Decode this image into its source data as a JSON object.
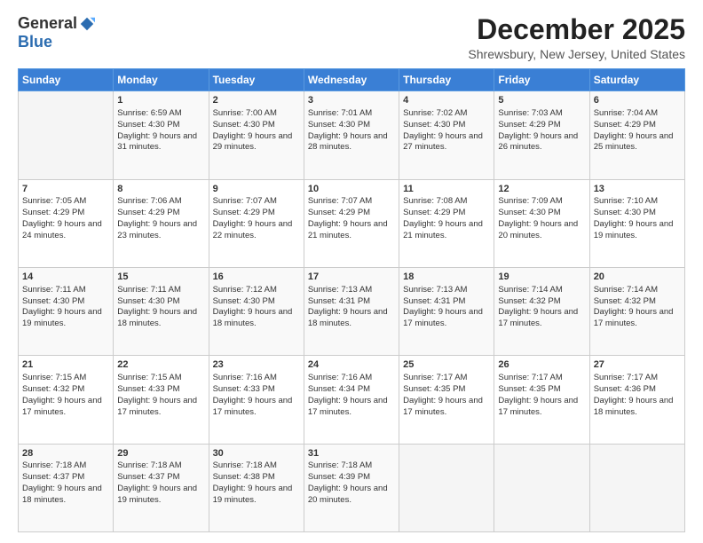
{
  "logo": {
    "general": "General",
    "blue": "Blue"
  },
  "header": {
    "month": "December 2025",
    "location": "Shrewsbury, New Jersey, United States"
  },
  "weekdays": [
    "Sunday",
    "Monday",
    "Tuesday",
    "Wednesday",
    "Thursday",
    "Friday",
    "Saturday"
  ],
  "weeks": [
    [
      {
        "day": "",
        "sunrise": "",
        "sunset": "",
        "daylight": ""
      },
      {
        "day": "1",
        "sunrise": "Sunrise: 6:59 AM",
        "sunset": "Sunset: 4:30 PM",
        "daylight": "Daylight: 9 hours and 31 minutes."
      },
      {
        "day": "2",
        "sunrise": "Sunrise: 7:00 AM",
        "sunset": "Sunset: 4:30 PM",
        "daylight": "Daylight: 9 hours and 29 minutes."
      },
      {
        "day": "3",
        "sunrise": "Sunrise: 7:01 AM",
        "sunset": "Sunset: 4:30 PM",
        "daylight": "Daylight: 9 hours and 28 minutes."
      },
      {
        "day": "4",
        "sunrise": "Sunrise: 7:02 AM",
        "sunset": "Sunset: 4:30 PM",
        "daylight": "Daylight: 9 hours and 27 minutes."
      },
      {
        "day": "5",
        "sunrise": "Sunrise: 7:03 AM",
        "sunset": "Sunset: 4:29 PM",
        "daylight": "Daylight: 9 hours and 26 minutes."
      },
      {
        "day": "6",
        "sunrise": "Sunrise: 7:04 AM",
        "sunset": "Sunset: 4:29 PM",
        "daylight": "Daylight: 9 hours and 25 minutes."
      }
    ],
    [
      {
        "day": "7",
        "sunrise": "Sunrise: 7:05 AM",
        "sunset": "Sunset: 4:29 PM",
        "daylight": "Daylight: 9 hours and 24 minutes."
      },
      {
        "day": "8",
        "sunrise": "Sunrise: 7:06 AM",
        "sunset": "Sunset: 4:29 PM",
        "daylight": "Daylight: 9 hours and 23 minutes."
      },
      {
        "day": "9",
        "sunrise": "Sunrise: 7:07 AM",
        "sunset": "Sunset: 4:29 PM",
        "daylight": "Daylight: 9 hours and 22 minutes."
      },
      {
        "day": "10",
        "sunrise": "Sunrise: 7:07 AM",
        "sunset": "Sunset: 4:29 PM",
        "daylight": "Daylight: 9 hours and 21 minutes."
      },
      {
        "day": "11",
        "sunrise": "Sunrise: 7:08 AM",
        "sunset": "Sunset: 4:29 PM",
        "daylight": "Daylight: 9 hours and 21 minutes."
      },
      {
        "day": "12",
        "sunrise": "Sunrise: 7:09 AM",
        "sunset": "Sunset: 4:30 PM",
        "daylight": "Daylight: 9 hours and 20 minutes."
      },
      {
        "day": "13",
        "sunrise": "Sunrise: 7:10 AM",
        "sunset": "Sunset: 4:30 PM",
        "daylight": "Daylight: 9 hours and 19 minutes."
      }
    ],
    [
      {
        "day": "14",
        "sunrise": "Sunrise: 7:11 AM",
        "sunset": "Sunset: 4:30 PM",
        "daylight": "Daylight: 9 hours and 19 minutes."
      },
      {
        "day": "15",
        "sunrise": "Sunrise: 7:11 AM",
        "sunset": "Sunset: 4:30 PM",
        "daylight": "Daylight: 9 hours and 18 minutes."
      },
      {
        "day": "16",
        "sunrise": "Sunrise: 7:12 AM",
        "sunset": "Sunset: 4:30 PM",
        "daylight": "Daylight: 9 hours and 18 minutes."
      },
      {
        "day": "17",
        "sunrise": "Sunrise: 7:13 AM",
        "sunset": "Sunset: 4:31 PM",
        "daylight": "Daylight: 9 hours and 18 minutes."
      },
      {
        "day": "18",
        "sunrise": "Sunrise: 7:13 AM",
        "sunset": "Sunset: 4:31 PM",
        "daylight": "Daylight: 9 hours and 17 minutes."
      },
      {
        "day": "19",
        "sunrise": "Sunrise: 7:14 AM",
        "sunset": "Sunset: 4:32 PM",
        "daylight": "Daylight: 9 hours and 17 minutes."
      },
      {
        "day": "20",
        "sunrise": "Sunrise: 7:14 AM",
        "sunset": "Sunset: 4:32 PM",
        "daylight": "Daylight: 9 hours and 17 minutes."
      }
    ],
    [
      {
        "day": "21",
        "sunrise": "Sunrise: 7:15 AM",
        "sunset": "Sunset: 4:32 PM",
        "daylight": "Daylight: 9 hours and 17 minutes."
      },
      {
        "day": "22",
        "sunrise": "Sunrise: 7:15 AM",
        "sunset": "Sunset: 4:33 PM",
        "daylight": "Daylight: 9 hours and 17 minutes."
      },
      {
        "day": "23",
        "sunrise": "Sunrise: 7:16 AM",
        "sunset": "Sunset: 4:33 PM",
        "daylight": "Daylight: 9 hours and 17 minutes."
      },
      {
        "day": "24",
        "sunrise": "Sunrise: 7:16 AM",
        "sunset": "Sunset: 4:34 PM",
        "daylight": "Daylight: 9 hours and 17 minutes."
      },
      {
        "day": "25",
        "sunrise": "Sunrise: 7:17 AM",
        "sunset": "Sunset: 4:35 PM",
        "daylight": "Daylight: 9 hours and 17 minutes."
      },
      {
        "day": "26",
        "sunrise": "Sunrise: 7:17 AM",
        "sunset": "Sunset: 4:35 PM",
        "daylight": "Daylight: 9 hours and 17 minutes."
      },
      {
        "day": "27",
        "sunrise": "Sunrise: 7:17 AM",
        "sunset": "Sunset: 4:36 PM",
        "daylight": "Daylight: 9 hours and 18 minutes."
      }
    ],
    [
      {
        "day": "28",
        "sunrise": "Sunrise: 7:18 AM",
        "sunset": "Sunset: 4:37 PM",
        "daylight": "Daylight: 9 hours and 18 minutes."
      },
      {
        "day": "29",
        "sunrise": "Sunrise: 7:18 AM",
        "sunset": "Sunset: 4:37 PM",
        "daylight": "Daylight: 9 hours and 19 minutes."
      },
      {
        "day": "30",
        "sunrise": "Sunrise: 7:18 AM",
        "sunset": "Sunset: 4:38 PM",
        "daylight": "Daylight: 9 hours and 19 minutes."
      },
      {
        "day": "31",
        "sunrise": "Sunrise: 7:18 AM",
        "sunset": "Sunset: 4:39 PM",
        "daylight": "Daylight: 9 hours and 20 minutes."
      },
      {
        "day": "",
        "sunrise": "",
        "sunset": "",
        "daylight": ""
      },
      {
        "day": "",
        "sunrise": "",
        "sunset": "",
        "daylight": ""
      },
      {
        "day": "",
        "sunrise": "",
        "sunset": "",
        "daylight": ""
      }
    ]
  ]
}
